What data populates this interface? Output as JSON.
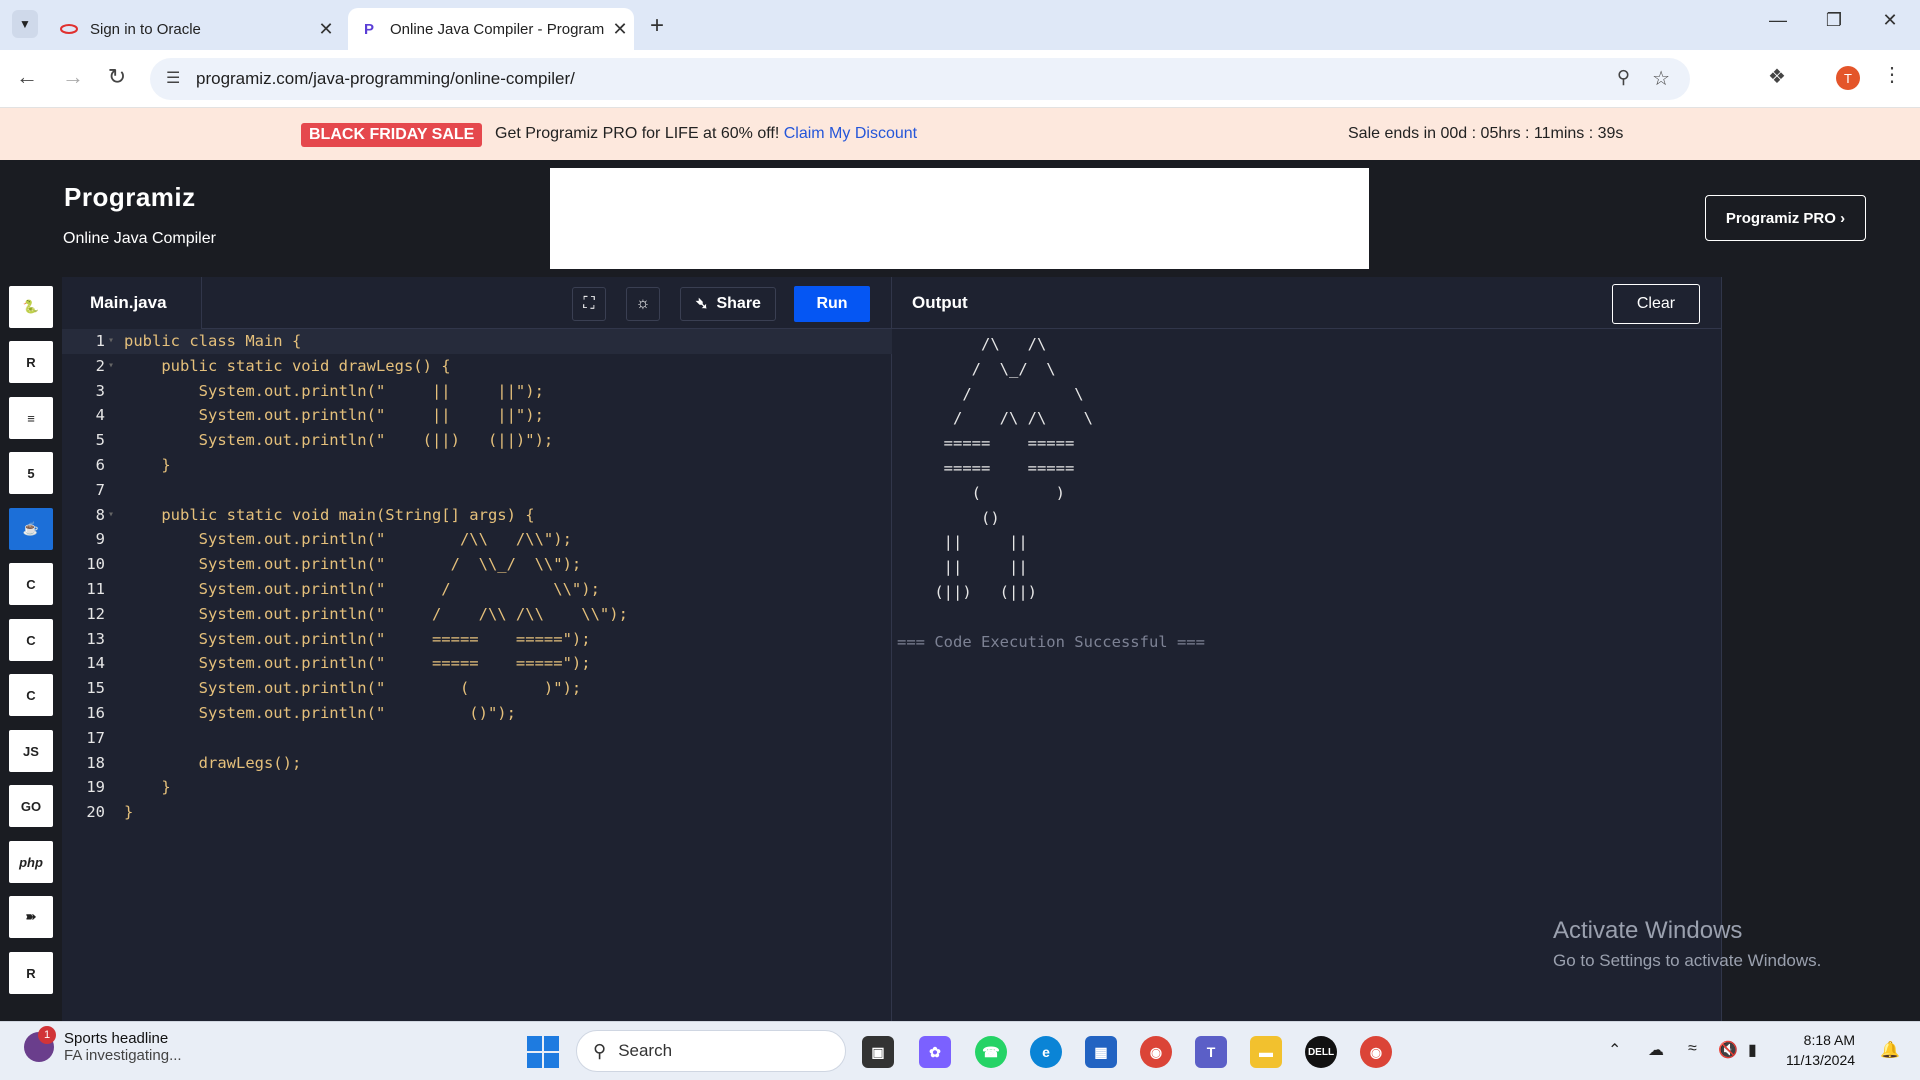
{
  "browser": {
    "tabs": [
      {
        "title": "Sign in to Oracle"
      },
      {
        "title": "Online Java Compiler - Program"
      }
    ],
    "url": "programiz.com/java-programming/online-compiler/",
    "avatar_letter": "T"
  },
  "promo": {
    "badge": "BLACK FRIDAY SALE",
    "text": "Get Programiz PRO for LIFE at 60% off!",
    "link": "Claim My Discount",
    "countdown": "Sale ends in 00d : 05hrs : 11mins : 39s"
  },
  "header": {
    "brand": "Programiz",
    "subtitle": "Online Java Compiler",
    "pro_button": "Programiz PRO ›"
  },
  "languages": [
    {
      "name": "python-icon",
      "label": "🐍"
    },
    {
      "name": "r-icon",
      "label": "R"
    },
    {
      "name": "sql-icon",
      "label": "≡"
    },
    {
      "name": "html-icon",
      "label": "5"
    },
    {
      "name": "java-icon",
      "label": "☕"
    },
    {
      "name": "c-icon",
      "label": "C"
    },
    {
      "name": "cpp-icon",
      "label": "C"
    },
    {
      "name": "csharp-icon",
      "label": "C"
    },
    {
      "name": "js-icon",
      "label": "JS"
    },
    {
      "name": "go-icon",
      "label": "GO"
    },
    {
      "name": "php-icon",
      "label": "php"
    },
    {
      "name": "swift-icon",
      "label": "➽"
    },
    {
      "name": "rust-icon",
      "label": "R"
    }
  ],
  "editor": {
    "filename": "Main.java",
    "share_label": "Share",
    "run_label": "Run",
    "lines": [
      "public class Main {",
      "    public static void drawLegs() {",
      "        System.out.println(\"     ||     ||\");",
      "        System.out.println(\"     ||     ||\");",
      "        System.out.println(\"    (||)   (||)\");",
      "    }",
      "",
      "    public static void main(String[] args) {",
      "        System.out.println(\"        /\\\\   /\\\\\");",
      "        System.out.println(\"       /  \\\\_/  \\\\\");",
      "        System.out.println(\"      /           \\\\\");",
      "        System.out.println(\"     /    /\\\\ /\\\\    \\\\\");",
      "        System.out.println(\"     =====    =====\");",
      "        System.out.println(\"     =====    =====\");",
      "        System.out.println(\"        (        )\");",
      "        System.out.println(\"         ()\");",
      "",
      "        drawLegs();",
      "    }",
      "}"
    ]
  },
  "output": {
    "title": "Output",
    "clear_label": "Clear",
    "lines": [
      "         /\\   /\\",
      "        /  \\_/  \\",
      "       /           \\",
      "      /    /\\ /\\    \\",
      "     =====    =====",
      "     =====    =====",
      "        (        )",
      "         ()",
      "     ||     ||",
      "     ||     ||",
      "    (||)   (||)",
      "",
      "=== Code Execution Successful ==="
    ]
  },
  "watermark": {
    "title": "Activate Windows",
    "subtitle": "Go to Settings to activate Windows."
  },
  "taskbar": {
    "news_title": "Sports headline",
    "news_sub": "FA investigating...",
    "news_badge": "1",
    "search_placeholder": "Search",
    "time": "8:18 AM",
    "date": "11/13/2024"
  }
}
